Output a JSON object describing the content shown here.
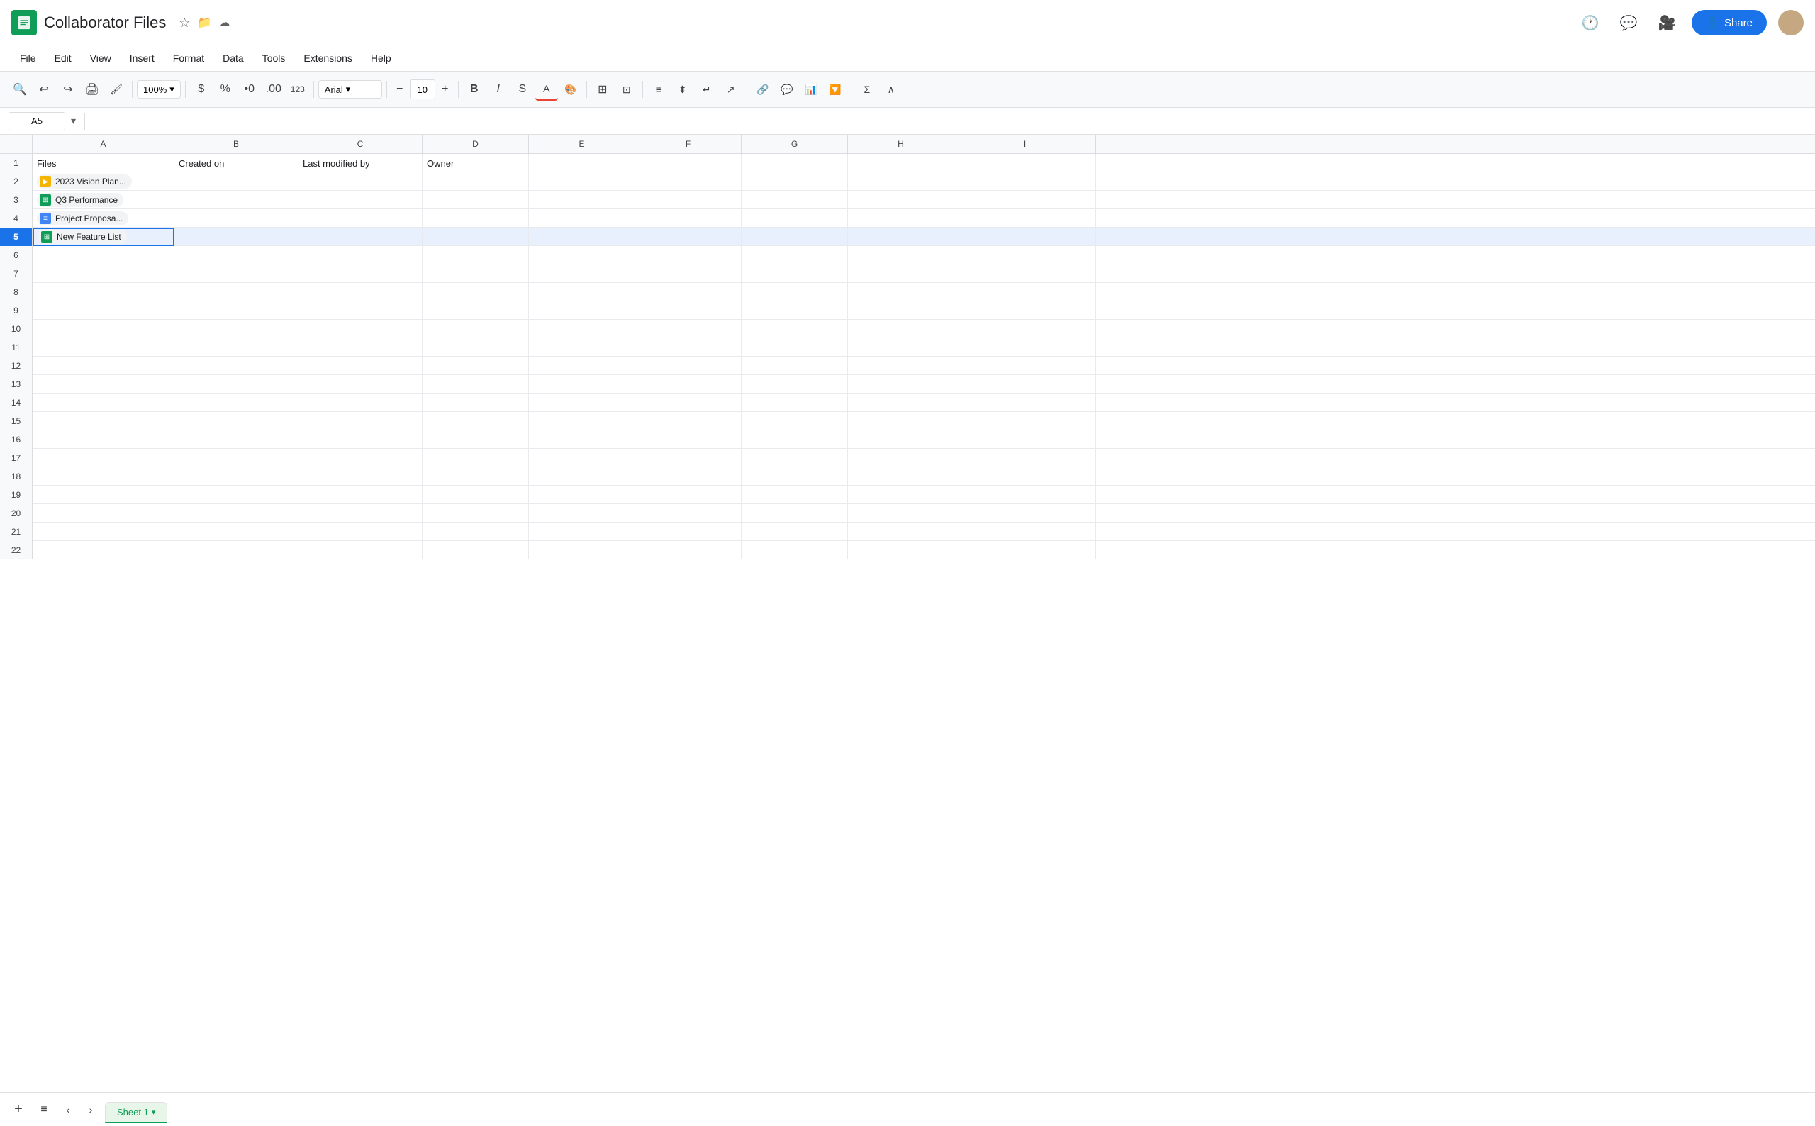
{
  "app": {
    "logo_color": "#0f9d58",
    "title": "Collaborator Files",
    "favicon": "sheets"
  },
  "title_icons": {
    "star": "☆",
    "folder": "📁",
    "cloud": "☁"
  },
  "menu": {
    "items": [
      "File",
      "Edit",
      "View",
      "Insert",
      "Format",
      "Data",
      "Tools",
      "Extensions",
      "Help"
    ]
  },
  "toolbar": {
    "zoom": "100%",
    "font": "Arial",
    "font_size": "10",
    "bold": "B",
    "italic": "I",
    "strikethrough": "S"
  },
  "formula_bar": {
    "cell_ref": "A5",
    "formula": ""
  },
  "columns": [
    "A",
    "B",
    "C",
    "D",
    "E",
    "F",
    "G",
    "H",
    "I"
  ],
  "rows": [
    {
      "num": 1,
      "cells": [
        "Files",
        "Created on",
        "Last modified by",
        "Owner",
        "",
        "",
        "",
        "",
        ""
      ]
    },
    {
      "num": 2,
      "cells": [
        "2023 Vision Plan...",
        "",
        "",
        "",
        "",
        "",
        "",
        "",
        ""
      ],
      "file_type": "slides",
      "file_icon_class": "icon-slides"
    },
    {
      "num": 3,
      "cells": [
        "Q3 Performance",
        "",
        "",
        "",
        "",
        "",
        "",
        "",
        ""
      ],
      "file_type": "sheets",
      "file_icon_class": "icon-sheets"
    },
    {
      "num": 4,
      "cells": [
        "Project Proposa...",
        "",
        "",
        "",
        "",
        "",
        "",
        "",
        ""
      ],
      "file_type": "docs",
      "file_icon_class": "icon-docs"
    },
    {
      "num": 5,
      "cells": [
        "New Feature List",
        "",
        "",
        "",
        "",
        "",
        "",
        "",
        ""
      ],
      "file_type": "sheets",
      "file_icon_class": "icon-sheets"
    },
    {
      "num": 6,
      "cells": [
        "",
        "",
        "",
        "",
        "",
        "",
        "",
        "",
        ""
      ]
    },
    {
      "num": 7,
      "cells": [
        "",
        "",
        "",
        "",
        "",
        "",
        "",
        "",
        ""
      ]
    },
    {
      "num": 8,
      "cells": [
        "",
        "",
        "",
        "",
        "",
        "",
        "",
        "",
        ""
      ]
    },
    {
      "num": 9,
      "cells": [
        "",
        "",
        "",
        "",
        "",
        "",
        "",
        "",
        ""
      ]
    },
    {
      "num": 10,
      "cells": [
        "",
        "",
        "",
        "",
        "",
        "",
        "",
        "",
        ""
      ]
    },
    {
      "num": 11,
      "cells": [
        "",
        "",
        "",
        "",
        "",
        "",
        "",
        "",
        ""
      ]
    },
    {
      "num": 12,
      "cells": [
        "",
        "",
        "",
        "",
        "",
        "",
        "",
        "",
        ""
      ]
    },
    {
      "num": 13,
      "cells": [
        "",
        "",
        "",
        "",
        "",
        "",
        "",
        "",
        ""
      ]
    },
    {
      "num": 14,
      "cells": [
        "",
        "",
        "",
        "",
        "",
        "",
        "",
        "",
        ""
      ]
    },
    {
      "num": 15,
      "cells": [
        "",
        "",
        "",
        "",
        "",
        "",
        "",
        "",
        ""
      ]
    },
    {
      "num": 16,
      "cells": [
        "",
        "",
        "",
        "",
        "",
        "",
        "",
        "",
        ""
      ]
    },
    {
      "num": 17,
      "cells": [
        "",
        "",
        "",
        "",
        "",
        "",
        "",
        "",
        ""
      ]
    },
    {
      "num": 18,
      "cells": [
        "",
        "",
        "",
        "",
        "",
        "",
        "",
        "",
        ""
      ]
    },
    {
      "num": 19,
      "cells": [
        "",
        "",
        "",
        "",
        "",
        "",
        "",
        "",
        ""
      ]
    },
    {
      "num": 20,
      "cells": [
        "",
        "",
        "",
        "",
        "",
        "",
        "",
        "",
        ""
      ]
    },
    {
      "num": 21,
      "cells": [
        "",
        "",
        "",
        "",
        "",
        "",
        "",
        "",
        ""
      ]
    },
    {
      "num": 22,
      "cells": [
        "",
        "",
        "",
        "",
        "",
        "",
        "",
        "",
        ""
      ]
    }
  ],
  "sheet_tabs": [
    {
      "label": "Sheet 1",
      "active": true
    }
  ],
  "share_button": {
    "label": "Share"
  }
}
